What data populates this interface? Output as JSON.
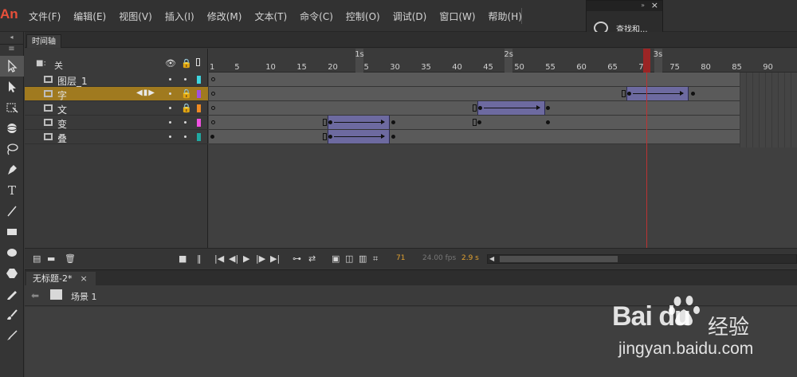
{
  "app": {
    "logo": "An"
  },
  "menubar": {
    "items": [
      "文件(F)",
      "编辑(E)",
      "视图(V)",
      "插入(I)",
      "修改(M)",
      "文本(T)",
      "命令(C)",
      "控制(O)",
      "调试(D)",
      "窗口(W)",
      "帮助(H)"
    ]
  },
  "find_panel": {
    "label": "查找和...",
    "collapse": "»",
    "close": "×"
  },
  "timeline": {
    "tab_label": "时间轴",
    "header_name": "关",
    "ruler": {
      "ticks": [
        "1",
        "5",
        "10",
        "15",
        "20",
        "25",
        "30",
        "35",
        "40",
        "45",
        "50",
        "55",
        "60",
        "65",
        "70",
        "75",
        "80",
        "85",
        "90"
      ],
      "seconds": [
        "1s",
        "2s",
        "3s"
      ]
    },
    "layers": [
      {
        "name": "图层_1",
        "color": "#3fd6e0",
        "locked": false,
        "selected": false
      },
      {
        "name": "字",
        "color": "#a050e0",
        "locked": true,
        "selected": true
      },
      {
        "name": "文",
        "color": "#f08a22",
        "locked": true,
        "selected": false
      },
      {
        "name": "变",
        "color": "#f050e0",
        "locked": false,
        "selected": false
      },
      {
        "name": "叠",
        "color": "#20a8a0",
        "locked": false,
        "selected": false
      }
    ],
    "current_frame": "71",
    "fps": "24.00 fps",
    "time": "2.9 s"
  },
  "document": {
    "tab_label": "无标题-2*",
    "tab_close": "×",
    "scene_label": "场景 1"
  },
  "watermark": {
    "brand": "Bai du",
    "chinese": "经验",
    "url": "jingyan.baidu.com"
  }
}
